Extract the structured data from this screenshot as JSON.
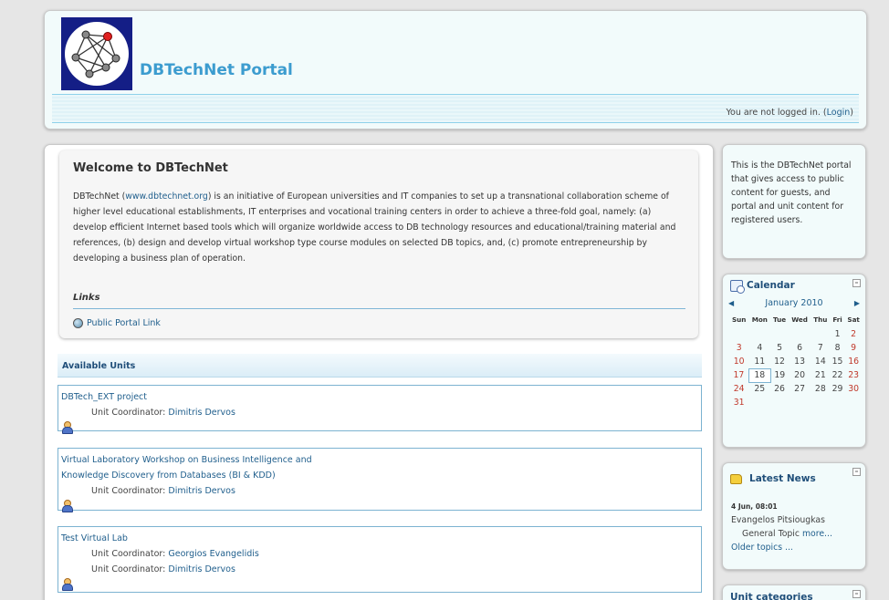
{
  "header": {
    "site_title": "DBTechNet Portal",
    "login_text": "You are not logged in. (",
    "login_link": "Login",
    "login_close": ")"
  },
  "welcome": {
    "title": "Welcome to DBTechNet",
    "text_start": "DBTechNet (",
    "text_link": "www.dbtechnet.org",
    "text_rest": ") is an initiative of European universities and IT companies to set up a transnational collaboration scheme of higher level educational establishments, IT enterprises and vocational training centers in order to achieve a three-fold goal, namely: (a) develop efficient Internet based tools which will organize worldwide access to DB technology resources and educational/training material and references, (b) design and develop virtual workshop type course modules on selected DB topics, and, (c) promote entrepreneurship by developing a business plan of operation."
  },
  "links": {
    "title": "Links",
    "public_portal": "Public Portal Link"
  },
  "units": {
    "title": "Available Units",
    "coord_label": "Unit Coordinator:",
    "items": [
      {
        "name": "DBTech_EXT project",
        "coordinators": [
          "Dimitris Dervos"
        ]
      },
      {
        "name_line1": "Virtual Laboratory Workshop on Business Intelligence and",
        "name_line2": "Knowledge Discovery from Databases (BI & KDD)",
        "coordinators": [
          "Dimitris Dervos"
        ]
      },
      {
        "name": "Test Virtual Lab",
        "coordinators": [
          "Georgios Evangelidis",
          "Dimitris Dervos"
        ]
      }
    ]
  },
  "sidebar": {
    "intro": "This is the DBTechNet portal that gives access to public content for guests, and portal and unit content for registered users.",
    "calendar": {
      "title": "Calendar",
      "month": "January 2010",
      "weekdays": [
        "Sun",
        "Mon",
        "Tue",
        "Wed",
        "Thu",
        "Fri",
        "Sat"
      ],
      "weeks": [
        [
          "",
          "",
          "",
          "",
          "",
          "1",
          "2"
        ],
        [
          "3",
          "4",
          "5",
          "6",
          "7",
          "8",
          "9"
        ],
        [
          "10",
          "11",
          "12",
          "13",
          "14",
          "15",
          "16"
        ],
        [
          "17",
          "18",
          "19",
          "20",
          "21",
          "22",
          "23"
        ],
        [
          "24",
          "25",
          "26",
          "27",
          "28",
          "29",
          "30"
        ],
        [
          "31",
          "",
          "",
          "",
          "",
          "",
          ""
        ]
      ],
      "today": "18"
    },
    "news": {
      "title": "Latest News",
      "date": "4 Jun, 08:01",
      "author": "Evangelos Pitsiougkas",
      "topic": "General Topic",
      "more": "more...",
      "older": "Older topics ..."
    },
    "categories": {
      "title": "Unit categories"
    }
  },
  "colors": {
    "accent": "#3c9ccf",
    "link": "#1f5e8c",
    "weekend": "#c0392b"
  }
}
